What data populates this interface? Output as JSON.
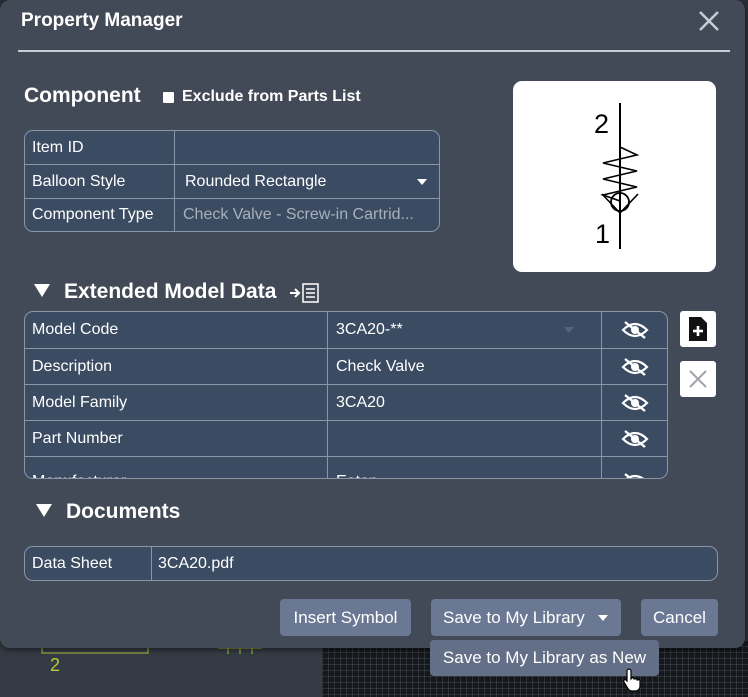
{
  "dialog": {
    "title": "Property Manager"
  },
  "component": {
    "heading": "Component",
    "exclude_label": "Exclude from Parts List",
    "exclude_checked": false,
    "rows": [
      {
        "label": "Item ID",
        "value": ""
      },
      {
        "label": "Balloon Style",
        "value": "Rounded Rectangle"
      },
      {
        "label": "Component Type",
        "value": "Check Valve - Screw-in Cartrid..."
      }
    ],
    "symbol": {
      "top_label": "2",
      "bottom_label": "1"
    }
  },
  "extended": {
    "heading": "Extended Model Data",
    "rows": [
      {
        "label": "Model Code",
        "value": "3CA20-**"
      },
      {
        "label": "Description",
        "value": "Check Valve"
      },
      {
        "label": "Model Family",
        "value": "3CA20"
      },
      {
        "label": "Part Number",
        "value": ""
      },
      {
        "label": "Manufacturer",
        "value": "Eaton"
      }
    ]
  },
  "documents": {
    "heading": "Documents",
    "rows": [
      {
        "label": "Data Sheet",
        "value": "3CA20.pdf"
      }
    ]
  },
  "buttons": {
    "insert_symbol": "Insert Symbol",
    "save_library": "Save to My Library",
    "cancel": "Cancel"
  },
  "tooltip": {
    "text": "Save to My Library as New"
  },
  "background": {
    "label": "2"
  },
  "colors": {
    "dialog_bg": "#434a57",
    "grid_bg": "#3a4b62",
    "button_bg": "#6b7894"
  }
}
